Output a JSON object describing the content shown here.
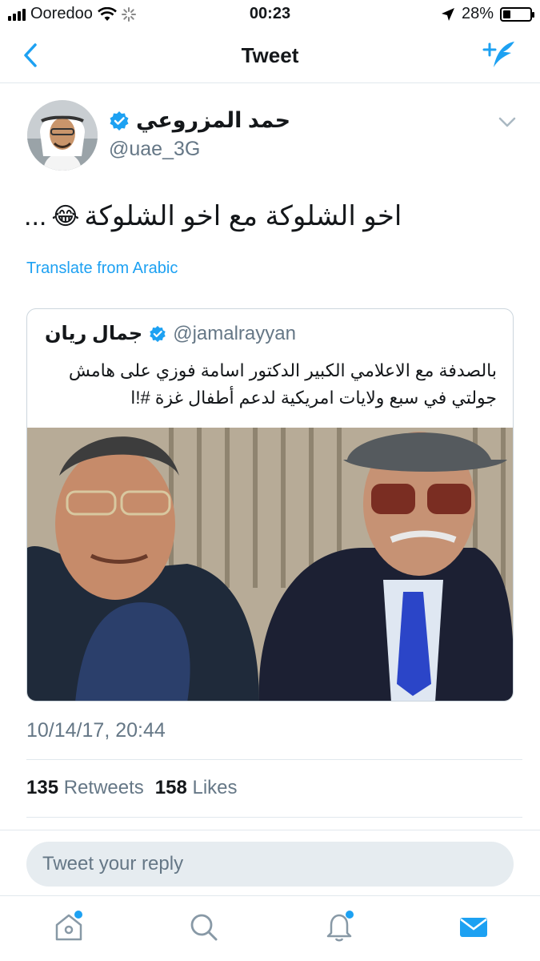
{
  "status_bar": {
    "carrier": "Ooredoo",
    "time": "00:23",
    "battery": "28%",
    "battery_level": 0.28
  },
  "nav": {
    "title": "Tweet",
    "back_icon": "chevron-left-icon",
    "compose_icon": "compose-tweet-icon"
  },
  "tweet": {
    "author_name": "حمد المزروعي",
    "author_handle": "@uae_3G",
    "text": "اخو الشلوكة مع اخو الشلوكة",
    "emoji": "😂",
    "ellipsis": "...",
    "translate": "Translate from Arabic",
    "timestamp": "10/14/17, 20:44",
    "retweets_count": "135",
    "retweets_label": "Retweets",
    "likes_count": "158",
    "likes_label": "Likes"
  },
  "quote": {
    "author_name": "جمال ريان",
    "author_handle": "@jamalrayyan",
    "text_line1": "بالصدفة مع الاعلامي الكبير الدكتور اسامة فوزي على هامش",
    "text_line2": "جولتي في سبع ولايات امريكية لدعم أطفال غزة #!ا"
  },
  "reply": {
    "placeholder": "Tweet your reply"
  },
  "tabs": [
    "home-icon",
    "search-icon",
    "notifications-icon",
    "messages-icon"
  ],
  "colors": {
    "accent": "#1da1f2",
    "text": "#14171a",
    "secondary": "#657786"
  }
}
